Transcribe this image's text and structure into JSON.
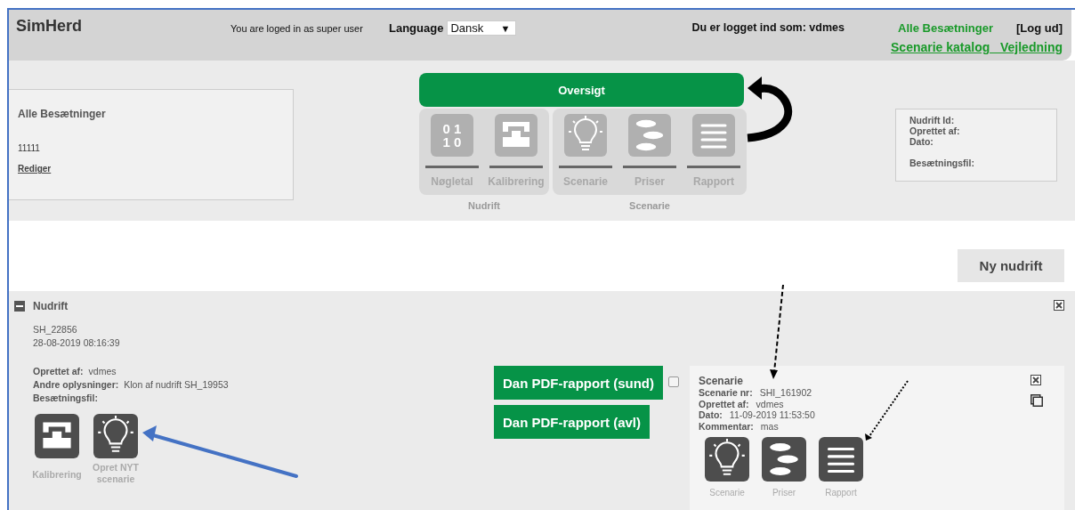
{
  "header": {
    "logo": "SimHerd",
    "login_note": "You are loged in as super user",
    "language_label": "Language",
    "language_value": "Dansk",
    "language_caret": "▼",
    "user_label": "Du er logget ind som: vdmes",
    "links": [
      "Alle Besætninger",
      "[Log ud]"
    ],
    "catalog_link": "Scenarie katalog _Vejledning"
  },
  "herd_card": {
    "title": "Alle Besætninger",
    "number": "11111",
    "edit_link": "Rediger"
  },
  "overview": {
    "title": "Oversigt",
    "groups": [
      {
        "label": "Nudrift",
        "items": [
          {
            "label": "Nøgletal",
            "kind": "binary",
            "digits": [
              "0 1",
              "1 0"
            ],
            "disabled": true
          },
          {
            "label": "Kalibrering",
            "kind": "scale",
            "disabled": true
          }
        ]
      },
      {
        "label": "Scenarie",
        "items": [
          {
            "label": "Scenarie",
            "kind": "bulb",
            "disabled": true
          },
          {
            "label": "Priser",
            "kind": "coins",
            "disabled": true
          },
          {
            "label": "Rapport",
            "kind": "lines",
            "disabled": true
          }
        ]
      }
    ]
  },
  "info_box": {
    "groups": [
      [
        "Nudrift Id:",
        "Oprettet af:",
        "Dato:"
      ],
      [
        "Besætningsfil:"
      ]
    ]
  },
  "new_button": "Ny nudrift",
  "nudrift": {
    "expanded": true,
    "title": "Nudrift",
    "id": "SH_22856",
    "date": "28-08-2019 08:16:39",
    "fields": [
      {
        "label": "Oprettet af:",
        "value": "vdmes"
      },
      {
        "label": "Andre oplysninger:",
        "value": "Klon af nudrift SH_19953"
      },
      {
        "label": "Besætningsfil:"
      }
    ],
    "actions": [
      {
        "label": "Kalibrering",
        "kind": "scale",
        "disabled": false
      },
      {
        "label": "Opret NYT scenarie",
        "kind": "bulb",
        "disabled": false
      }
    ]
  },
  "pdf_buttons": [
    "Dan PDF-rapport (sund)",
    "Dan PDF-rapport (avl)"
  ],
  "scenario": {
    "checked": false,
    "title": "Scenarie",
    "fields": [
      {
        "label": "Scenarie nr:",
        "value": "SHI_161902"
      },
      {
        "label": "Oprettet af:",
        "value": "vdmes"
      },
      {
        "label": "Dato:",
        "value": "11-09-2019 11:53:50"
      },
      {
        "label": "Kommentar:",
        "value": "mas"
      }
    ],
    "actions": [
      {
        "label": "Scenarie",
        "kind": "bulb",
        "disabled": false
      },
      {
        "label": "Priser",
        "kind": "coins",
        "disabled": false
      },
      {
        "label": "Rapport",
        "kind": "lines",
        "disabled": false
      }
    ]
  },
  "annotations": [
    {
      "kind": "curved"
    },
    {
      "kind": "dashed"
    },
    {
      "kind": "dotted"
    },
    {
      "kind": "highlight"
    }
  ]
}
